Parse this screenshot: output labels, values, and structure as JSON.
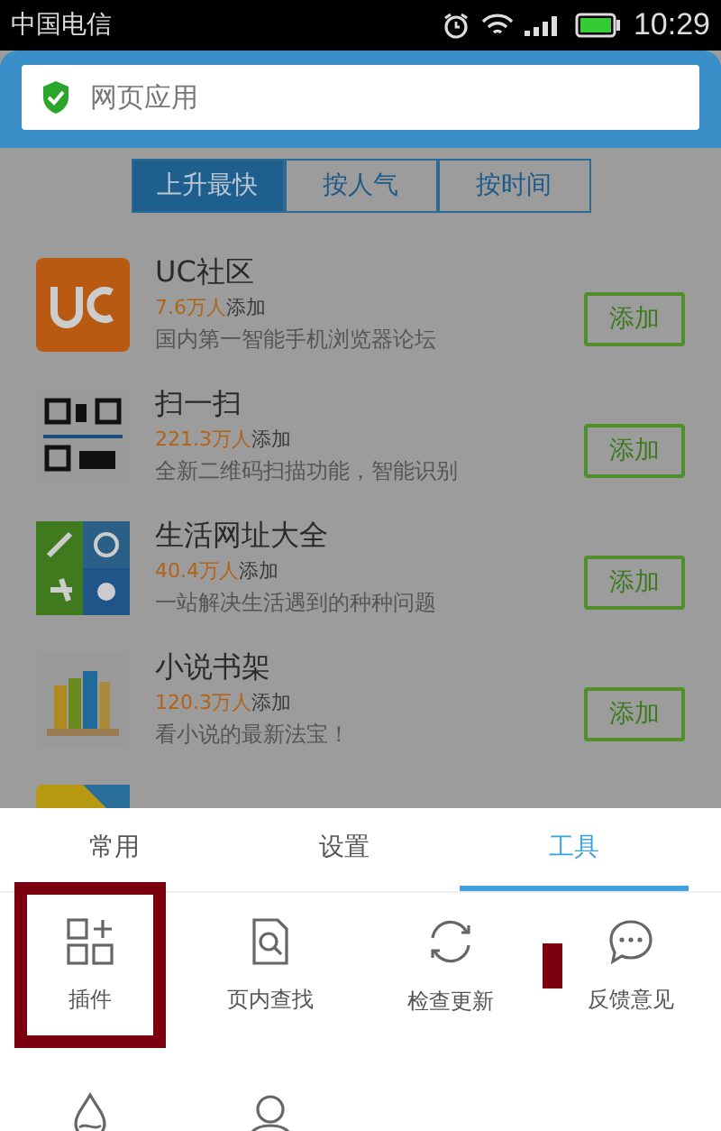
{
  "status_bar": {
    "carrier": "中国电信",
    "time": "10:29"
  },
  "address_bar": {
    "value": "网页应用"
  },
  "sort_tabs": [
    {
      "label": "上升最快",
      "selected": true
    },
    {
      "label": "按人气",
      "selected": false
    },
    {
      "label": "按时间",
      "selected": false
    }
  ],
  "apps": [
    {
      "kind": "uc",
      "name": "UC社区",
      "count": "7.6万人",
      "count_suffix": "添加",
      "description": "国内第一智能手机浏览器论坛",
      "button": "添加"
    },
    {
      "kind": "qr",
      "name": "扫一扫",
      "count": "221.3万人",
      "count_suffix": "添加",
      "description": "全新二维码扫描功能，智能识别",
      "button": "添加"
    },
    {
      "kind": "life",
      "name": "生活网址大全",
      "count": "40.4万人",
      "count_suffix": "添加",
      "description": "一站解决生活遇到的种种问题",
      "button": "添加"
    },
    {
      "kind": "books",
      "name": "小说书架",
      "count": "120.3万人",
      "count_suffix": "添加",
      "description": "看小说的最新法宝！",
      "button": "添加"
    },
    {
      "kind": "plugin"
    }
  ],
  "menu_tabs": [
    {
      "label": "常用",
      "selected": false
    },
    {
      "label": "设置",
      "selected": false
    },
    {
      "label": "工具",
      "selected": true
    }
  ],
  "tools": [
    {
      "kind": "plugin",
      "label": "插件",
      "highlighted": true
    },
    {
      "kind": "find",
      "label": "页内查找",
      "highlighted": false
    },
    {
      "kind": "update",
      "label": "检查更新",
      "highlighted": false
    },
    {
      "kind": "feedback",
      "label": "反馈意见",
      "highlighted": false
    },
    {
      "kind": "drop"
    },
    {
      "kind": "user"
    }
  ]
}
